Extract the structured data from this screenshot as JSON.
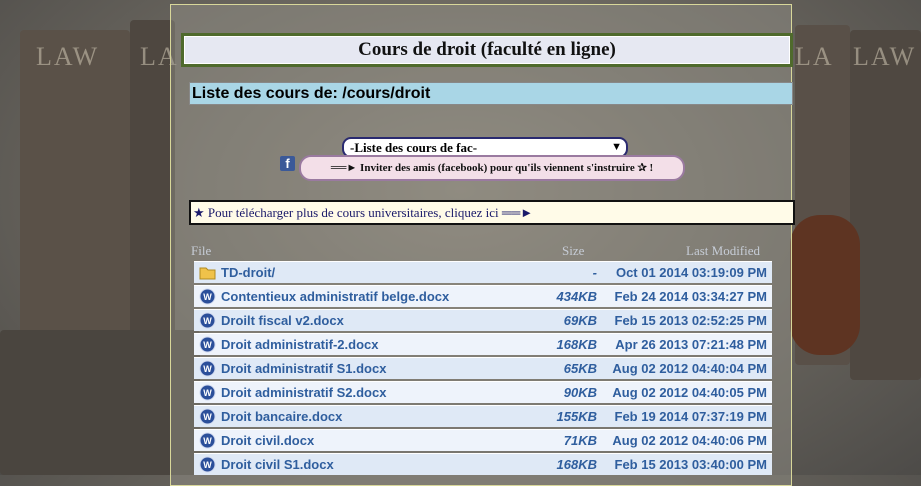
{
  "header": {
    "title": "Cours de droit (faculté en ligne)"
  },
  "path_bar": {
    "label": "Liste des cours de: /cours/droit"
  },
  "course_select": {
    "selected": "-Liste des cours de fac-"
  },
  "invite": {
    "label": "══► Inviter des amis (facebook) pour qu'ils viennent s'instruire ✰ !"
  },
  "more_courses": {
    "label": "★ Pour télécharger plus de cours universitaires, cliquez ici ══►"
  },
  "table": {
    "columns": {
      "file": "File",
      "size": "Size",
      "modified": "Last Modified"
    },
    "rows": [
      {
        "icon": "folder-icon",
        "name": "TD-droit/",
        "size": "-",
        "modified": "Oct 01 2014 03:19:09 PM"
      },
      {
        "icon": "word-doc-icon",
        "name": "Contentieux administratif belge.docx",
        "size": "434KB",
        "modified": "Feb 24 2014 03:34:27 PM"
      },
      {
        "icon": "word-doc-icon",
        "name": "Droilt fiscal v2.docx",
        "size": "69KB",
        "modified": "Feb 15 2013 02:52:25 PM"
      },
      {
        "icon": "word-doc-icon",
        "name": "Droit administratif-2.docx",
        "size": "168KB",
        "modified": "Apr 26 2013 07:21:48 PM"
      },
      {
        "icon": "word-doc-icon",
        "name": "Droit administratif S1.docx",
        "size": "65KB",
        "modified": "Aug 02 2012 04:40:04 PM"
      },
      {
        "icon": "word-doc-icon",
        "name": "Droit administratif S2.docx",
        "size": "90KB",
        "modified": "Aug 02 2012 04:40:05 PM"
      },
      {
        "icon": "word-doc-icon",
        "name": "Droit bancaire.docx",
        "size": "155KB",
        "modified": "Feb 19 2014 07:37:19 PM"
      },
      {
        "icon": "word-doc-icon",
        "name": "Droit civil.docx",
        "size": "71KB",
        "modified": "Aug 02 2012 04:40:06 PM"
      },
      {
        "icon": "word-doc-icon",
        "name": "Droit civil S1.docx",
        "size": "168KB",
        "modified": "Feb 15 2013 03:40:00 PM"
      }
    ]
  },
  "colors": {
    "accent": "#2f5e9e",
    "path_bg": "#a9d6e6",
    "title_border": "#4f6a2c"
  }
}
